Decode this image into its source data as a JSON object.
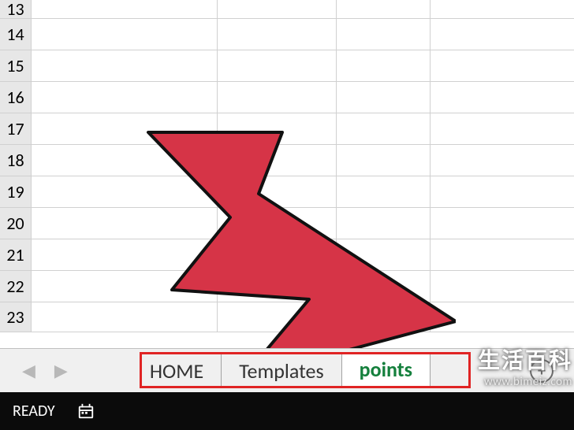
{
  "grid": {
    "row_numbers": [
      13,
      14,
      15,
      16,
      17,
      18,
      19,
      20,
      21,
      22,
      23
    ],
    "cols_visible": 4
  },
  "tabs": {
    "items": [
      "HOME",
      "Templates",
      "points"
    ],
    "active_index": 2
  },
  "nav": {
    "prev_glyph": "◀",
    "next_glyph": "▶"
  },
  "new_sheet": {
    "glyph": "+"
  },
  "status": {
    "text": "READY"
  },
  "annotation": {
    "arrow_color": "#d63447",
    "arrow_stroke": "#111111",
    "highlight_color": "#e02424"
  },
  "watermark": {
    "title": "生活百科",
    "url": "www.bimeiz.com"
  }
}
